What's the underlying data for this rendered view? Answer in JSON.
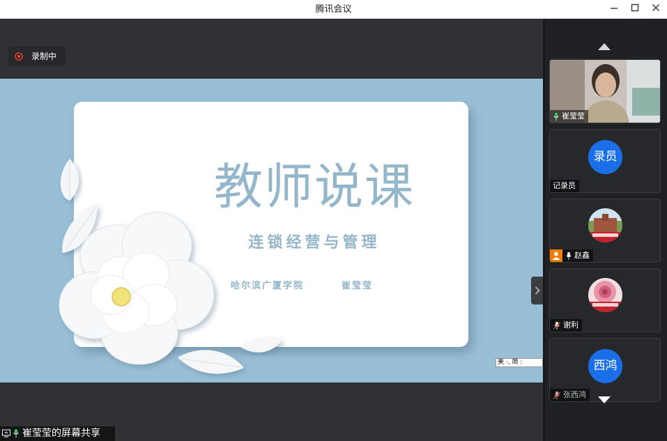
{
  "window": {
    "title": "腾讯会议"
  },
  "recording": {
    "label": "录制中"
  },
  "slide": {
    "title": "教师说课",
    "subtitle": "连锁经营与管理",
    "school": "哈尔滨广厦学院",
    "author": "崔莹莹"
  },
  "ime": {
    "text": "美 ·, 简 :"
  },
  "share_status": {
    "label": "崔莹莹的屏幕共享"
  },
  "participants": [
    {
      "name": "崔莹莹",
      "mic": "on",
      "type": "video"
    },
    {
      "name": "记录员",
      "avatar_text": "录员",
      "type": "text",
      "avatar_color": "#1a6fe8"
    },
    {
      "name": "赵鑫",
      "mic": "on",
      "host": true,
      "type": "image"
    },
    {
      "name": "谢利",
      "mic": "muted",
      "type": "image"
    },
    {
      "name": "张西鸿",
      "avatar_text": "西鸿",
      "mic": "muted",
      "type": "text",
      "avatar_color": "#1a6fe8"
    }
  ],
  "colors": {
    "slide_bg": "#99bfd7",
    "slide_text": "#93b6cb",
    "avatar_blue": "#1a6fe8",
    "host_orange": "#f07d00"
  }
}
